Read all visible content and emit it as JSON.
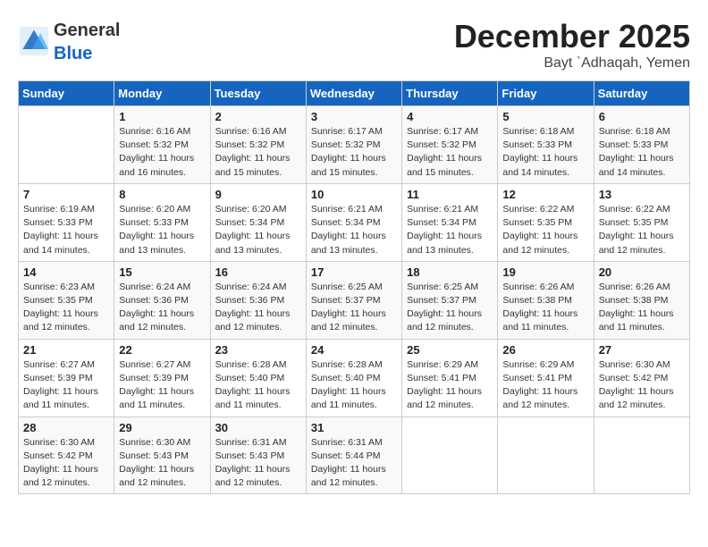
{
  "header": {
    "logo_general": "General",
    "logo_blue": "Blue",
    "title": "December 2025",
    "subtitle": "Bayt `Adhaqah, Yemen"
  },
  "calendar": {
    "days_of_week": [
      "Sunday",
      "Monday",
      "Tuesday",
      "Wednesday",
      "Thursday",
      "Friday",
      "Saturday"
    ],
    "weeks": [
      [
        {
          "num": "",
          "info": ""
        },
        {
          "num": "1",
          "info": "Sunrise: 6:16 AM\nSunset: 5:32 PM\nDaylight: 11 hours\nand 16 minutes."
        },
        {
          "num": "2",
          "info": "Sunrise: 6:16 AM\nSunset: 5:32 PM\nDaylight: 11 hours\nand 15 minutes."
        },
        {
          "num": "3",
          "info": "Sunrise: 6:17 AM\nSunset: 5:32 PM\nDaylight: 11 hours\nand 15 minutes."
        },
        {
          "num": "4",
          "info": "Sunrise: 6:17 AM\nSunset: 5:32 PM\nDaylight: 11 hours\nand 15 minutes."
        },
        {
          "num": "5",
          "info": "Sunrise: 6:18 AM\nSunset: 5:33 PM\nDaylight: 11 hours\nand 14 minutes."
        },
        {
          "num": "6",
          "info": "Sunrise: 6:18 AM\nSunset: 5:33 PM\nDaylight: 11 hours\nand 14 minutes."
        }
      ],
      [
        {
          "num": "7",
          "info": "Sunrise: 6:19 AM\nSunset: 5:33 PM\nDaylight: 11 hours\nand 14 minutes."
        },
        {
          "num": "8",
          "info": "Sunrise: 6:20 AM\nSunset: 5:33 PM\nDaylight: 11 hours\nand 13 minutes."
        },
        {
          "num": "9",
          "info": "Sunrise: 6:20 AM\nSunset: 5:34 PM\nDaylight: 11 hours\nand 13 minutes."
        },
        {
          "num": "10",
          "info": "Sunrise: 6:21 AM\nSunset: 5:34 PM\nDaylight: 11 hours\nand 13 minutes."
        },
        {
          "num": "11",
          "info": "Sunrise: 6:21 AM\nSunset: 5:34 PM\nDaylight: 11 hours\nand 13 minutes."
        },
        {
          "num": "12",
          "info": "Sunrise: 6:22 AM\nSunset: 5:35 PM\nDaylight: 11 hours\nand 12 minutes."
        },
        {
          "num": "13",
          "info": "Sunrise: 6:22 AM\nSunset: 5:35 PM\nDaylight: 11 hours\nand 12 minutes."
        }
      ],
      [
        {
          "num": "14",
          "info": "Sunrise: 6:23 AM\nSunset: 5:35 PM\nDaylight: 11 hours\nand 12 minutes."
        },
        {
          "num": "15",
          "info": "Sunrise: 6:24 AM\nSunset: 5:36 PM\nDaylight: 11 hours\nand 12 minutes."
        },
        {
          "num": "16",
          "info": "Sunrise: 6:24 AM\nSunset: 5:36 PM\nDaylight: 11 hours\nand 12 minutes."
        },
        {
          "num": "17",
          "info": "Sunrise: 6:25 AM\nSunset: 5:37 PM\nDaylight: 11 hours\nand 12 minutes."
        },
        {
          "num": "18",
          "info": "Sunrise: 6:25 AM\nSunset: 5:37 PM\nDaylight: 11 hours\nand 12 minutes."
        },
        {
          "num": "19",
          "info": "Sunrise: 6:26 AM\nSunset: 5:38 PM\nDaylight: 11 hours\nand 11 minutes."
        },
        {
          "num": "20",
          "info": "Sunrise: 6:26 AM\nSunset: 5:38 PM\nDaylight: 11 hours\nand 11 minutes."
        }
      ],
      [
        {
          "num": "21",
          "info": "Sunrise: 6:27 AM\nSunset: 5:39 PM\nDaylight: 11 hours\nand 11 minutes."
        },
        {
          "num": "22",
          "info": "Sunrise: 6:27 AM\nSunset: 5:39 PM\nDaylight: 11 hours\nand 11 minutes."
        },
        {
          "num": "23",
          "info": "Sunrise: 6:28 AM\nSunset: 5:40 PM\nDaylight: 11 hours\nand 11 minutes."
        },
        {
          "num": "24",
          "info": "Sunrise: 6:28 AM\nSunset: 5:40 PM\nDaylight: 11 hours\nand 11 minutes."
        },
        {
          "num": "25",
          "info": "Sunrise: 6:29 AM\nSunset: 5:41 PM\nDaylight: 11 hours\nand 12 minutes."
        },
        {
          "num": "26",
          "info": "Sunrise: 6:29 AM\nSunset: 5:41 PM\nDaylight: 11 hours\nand 12 minutes."
        },
        {
          "num": "27",
          "info": "Sunrise: 6:30 AM\nSunset: 5:42 PM\nDaylight: 11 hours\nand 12 minutes."
        }
      ],
      [
        {
          "num": "28",
          "info": "Sunrise: 6:30 AM\nSunset: 5:42 PM\nDaylight: 11 hours\nand 12 minutes."
        },
        {
          "num": "29",
          "info": "Sunrise: 6:30 AM\nSunset: 5:43 PM\nDaylight: 11 hours\nand 12 minutes."
        },
        {
          "num": "30",
          "info": "Sunrise: 6:31 AM\nSunset: 5:43 PM\nDaylight: 11 hours\nand 12 minutes."
        },
        {
          "num": "31",
          "info": "Sunrise: 6:31 AM\nSunset: 5:44 PM\nDaylight: 11 hours\nand 12 minutes."
        },
        {
          "num": "",
          "info": ""
        },
        {
          "num": "",
          "info": ""
        },
        {
          "num": "",
          "info": ""
        }
      ]
    ]
  }
}
